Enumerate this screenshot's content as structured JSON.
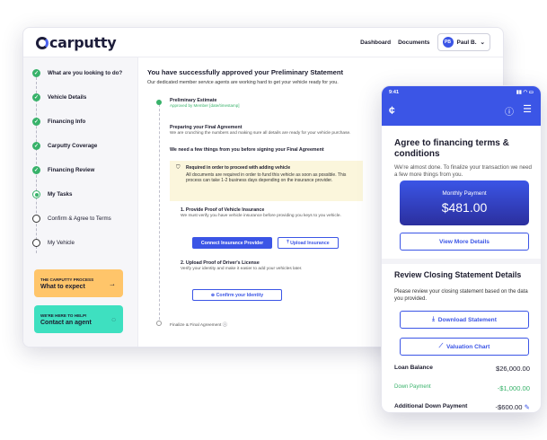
{
  "brand": {
    "logo": "carputty"
  },
  "header": {
    "nav": [
      "Dashboard",
      "Documents"
    ],
    "user": {
      "initials": "PB",
      "name": "Paul B."
    }
  },
  "sidebar": {
    "steps": [
      {
        "label": "What are you looking to do?",
        "state": "done"
      },
      {
        "label": "Vehicle Details",
        "state": "done"
      },
      {
        "label": "Financing Info",
        "state": "done"
      },
      {
        "label": "Carputty Coverage",
        "state": "done"
      },
      {
        "label": "Financing Review",
        "state": "done"
      },
      {
        "label": "My Tasks",
        "state": "current"
      },
      {
        "label": "Confirm & Agree to Terms",
        "state": "todo"
      },
      {
        "label": "My Vehicle",
        "state": "todo"
      }
    ],
    "cards": [
      {
        "kicker": "THE CARPUTTY PROCESS",
        "title": "What to expect",
        "color": "#ffc56a"
      },
      {
        "kicker": "WE'RE HERE TO HELP!",
        "title": "Contact an agent",
        "color": "#3ee0c0"
      }
    ]
  },
  "main": {
    "title": "You have successfully approved your Preliminary Statement",
    "subtitle": "Our dedicated member service agents are working hard to get your vehicle ready for you.",
    "timeline": [
      {
        "title": "Preliminary Estimate",
        "note": "Approved by Member [date/timestamp]"
      },
      {
        "title": "Preparing your Final Agreement",
        "note": "We are crunching the numbers and making sure all details are ready for your vehicle purchase."
      },
      {
        "title": "We need a few things from you before signing your Final Agreement"
      }
    ],
    "required": {
      "title": "Required in order to proceed with adding vehicle",
      "body": "All documents are required in order to fund this vehicle as soon as possible. This process can take 1-2 business days depending on the insurance provider."
    },
    "task1": {
      "title": "1. Provide Proof of Vehicle Insurance",
      "body": "We must verify you have vehicle insurance before providing you keys to you vehicle.",
      "btn_primary": "Connect Insurance Provider",
      "btn_secondary": "Upload Insurance"
    },
    "task2": {
      "title": "2. Upload Proof of Driver's License",
      "body": "Verify your identity and make it easier to add your vehicles later.",
      "btn": "Confirm your Identity"
    },
    "final": "Finalize & Final Agreement"
  },
  "phone": {
    "time": "9:41",
    "title": "Agree to financing terms & conditions",
    "subtitle": "We're almost done. To finalize your transaction we need a few more things from you.",
    "payment": {
      "label": "Monthly Payment",
      "value": "$481.00"
    },
    "more_btn": "View More Details",
    "review_title": "Review Closing Statement Details",
    "review_sub": "Please review your closing statement based on the data you provided.",
    "download_btn": "Download Statement",
    "chart_btn": "Valuation Chart",
    "rows": [
      {
        "label": "Loan Balance",
        "value": "$26,000.00"
      },
      {
        "label": "Down Payment",
        "value": "-$1,000.00"
      },
      {
        "label": "Additional Down Payment",
        "value": "-$600.00"
      }
    ]
  }
}
